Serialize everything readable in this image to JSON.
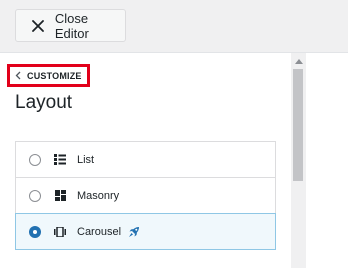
{
  "topbar": {
    "close_label": "Close Editor"
  },
  "panel": {
    "breadcrumb_label": "CUSTOMIZE",
    "title": "Layout",
    "options": [
      {
        "label": "List",
        "icon": "list-icon",
        "selected": false
      },
      {
        "label": "Masonry",
        "icon": "masonry-icon",
        "selected": false
      },
      {
        "label": "Carousel",
        "icon": "carousel-icon",
        "selected": true,
        "badge_icon": "rocket-icon"
      }
    ]
  },
  "colors": {
    "highlight_border": "#e2001a",
    "selected_radio": "#2271b1",
    "rocket": "#2271b1"
  }
}
